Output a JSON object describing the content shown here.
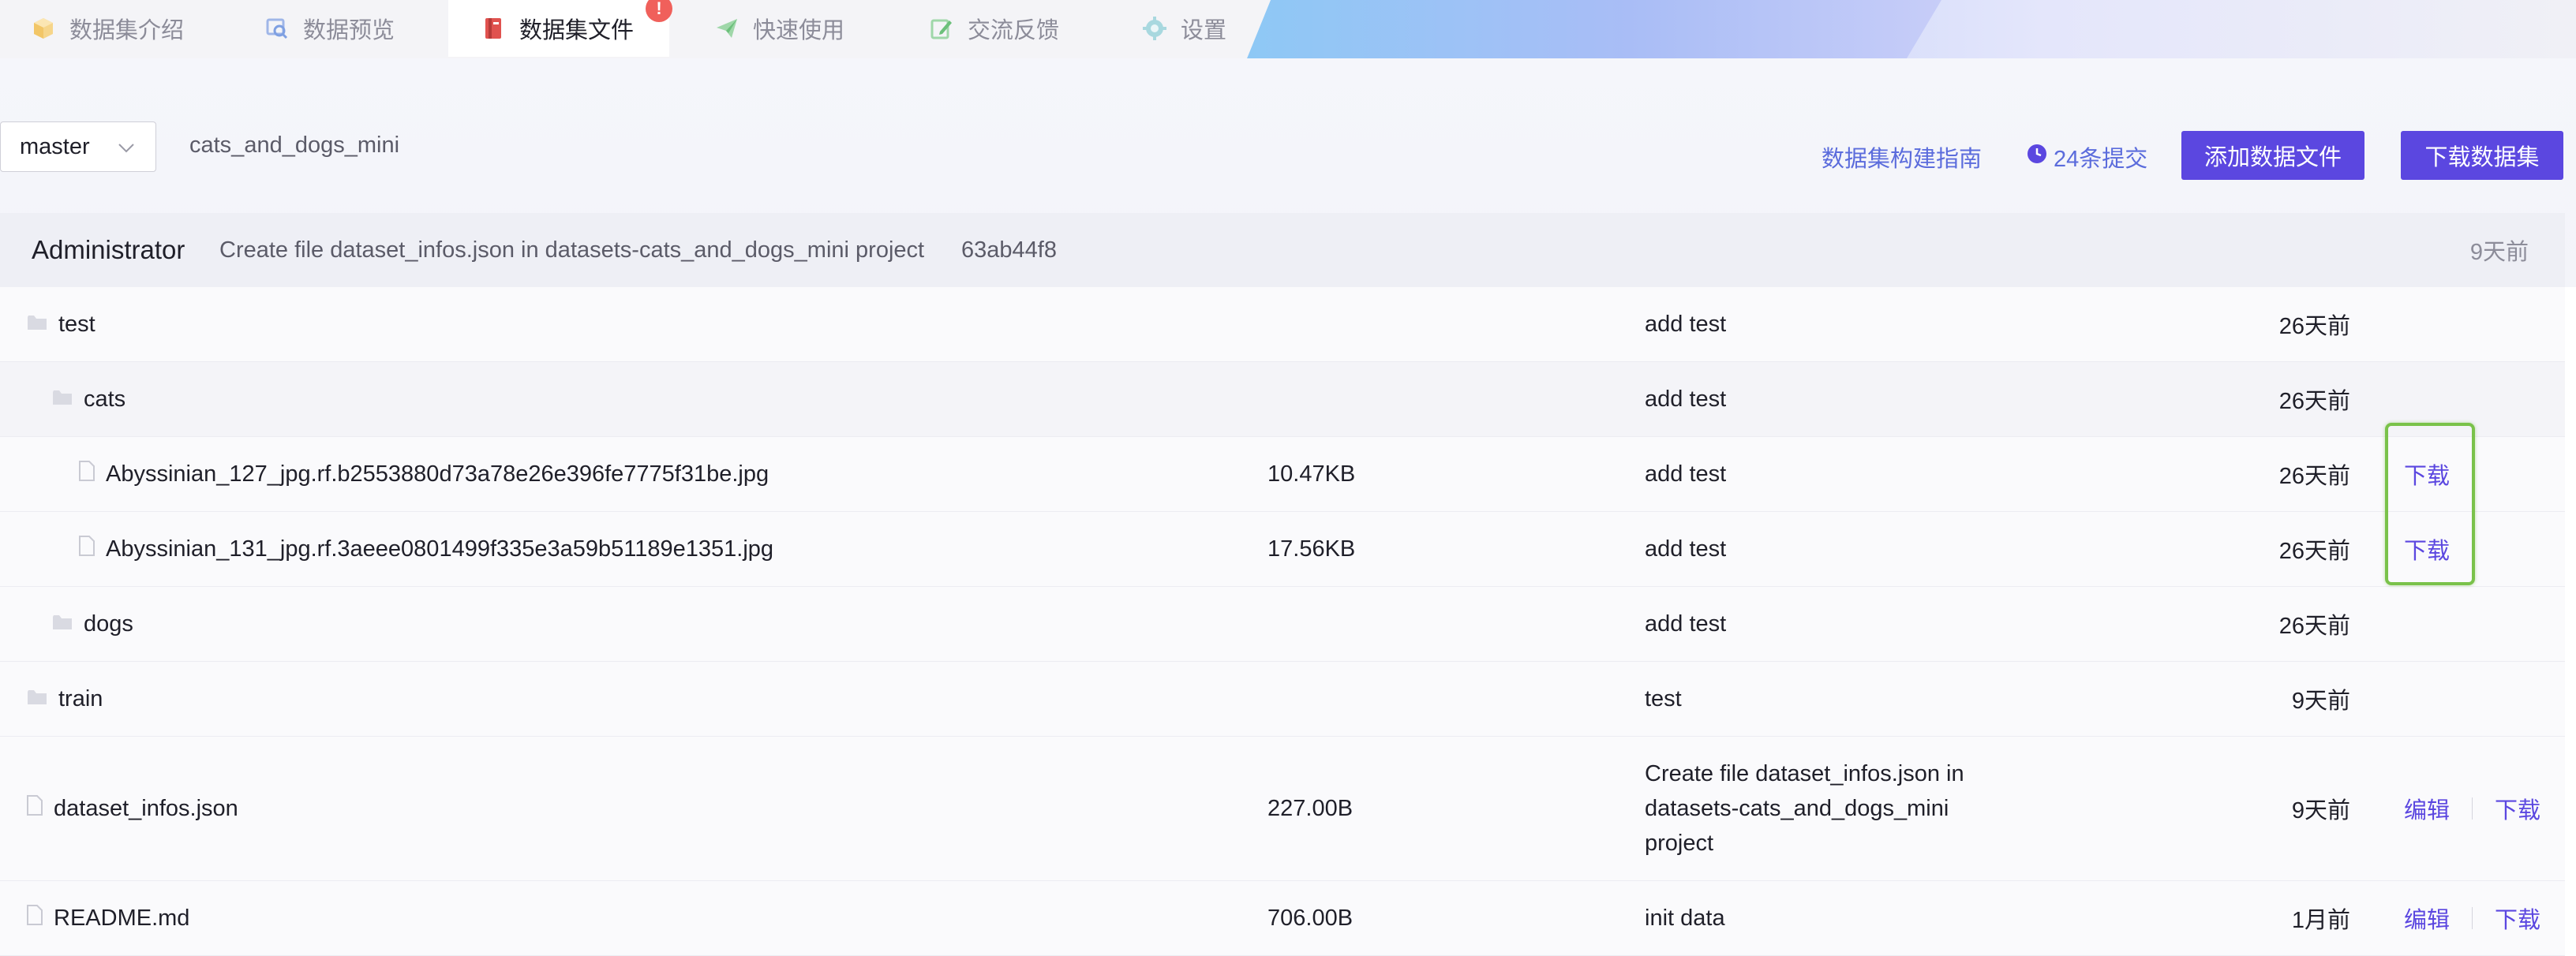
{
  "tabs": [
    {
      "label": "数据集介绍",
      "icon": "cube-icon",
      "active": false
    },
    {
      "label": "数据预览",
      "icon": "preview-icon",
      "active": false
    },
    {
      "label": "数据集文件",
      "icon": "book-icon",
      "active": true,
      "badge": "!"
    },
    {
      "label": "快速使用",
      "icon": "send-icon",
      "active": false
    },
    {
      "label": "交流反馈",
      "icon": "edit-icon",
      "active": false
    },
    {
      "label": "设置",
      "icon": "gear-icon",
      "active": false
    }
  ],
  "toolbar": {
    "branch": "master",
    "repo_name": "cats_and_dogs_mini",
    "guide_link": "数据集构建指南",
    "commits": "24条提交",
    "add_button": "添加数据文件",
    "download_button": "下载数据集"
  },
  "last_commit": {
    "author": "Administrator",
    "message": "Create file dataset_infos.json in datasets-cats_and_dogs_mini project",
    "hash": "63ab44f8",
    "time": "9天前"
  },
  "files": [
    {
      "name": "test",
      "type": "folder",
      "size": "",
      "message": "add test",
      "time": "26天前",
      "actions": []
    },
    {
      "name": "cats",
      "type": "folder",
      "size": "",
      "message": "add test",
      "time": "26天前",
      "actions": []
    },
    {
      "name": "Abyssinian_127_jpg.rf.b2553880d73a78e26e396fe7775f31be.jpg",
      "type": "file",
      "size": "10.47KB",
      "message": "add test",
      "time": "26天前",
      "actions": [
        "下载"
      ]
    },
    {
      "name": "Abyssinian_131_jpg.rf.3aeee0801499f335e3a59b51189e1351.jpg",
      "type": "file",
      "size": "17.56KB",
      "message": "add test",
      "time": "26天前",
      "actions": [
        "下载"
      ]
    },
    {
      "name": "dogs",
      "type": "folder",
      "size": "",
      "message": "add test",
      "time": "26天前",
      "actions": []
    },
    {
      "name": "train",
      "type": "folder",
      "size": "",
      "message": "test",
      "time": "9天前",
      "actions": []
    },
    {
      "name": "dataset_infos.json",
      "type": "file",
      "size": "227.00B",
      "message": "Create file dataset_infos.json in datasets-cats_and_dogs_mini project",
      "time": "9天前",
      "actions": [
        "编辑",
        "下载"
      ]
    },
    {
      "name": "README.md",
      "type": "file",
      "size": "706.00B",
      "message": "init data",
      "time": "1月前",
      "actions": [
        "编辑",
        "下载"
      ]
    }
  ]
}
